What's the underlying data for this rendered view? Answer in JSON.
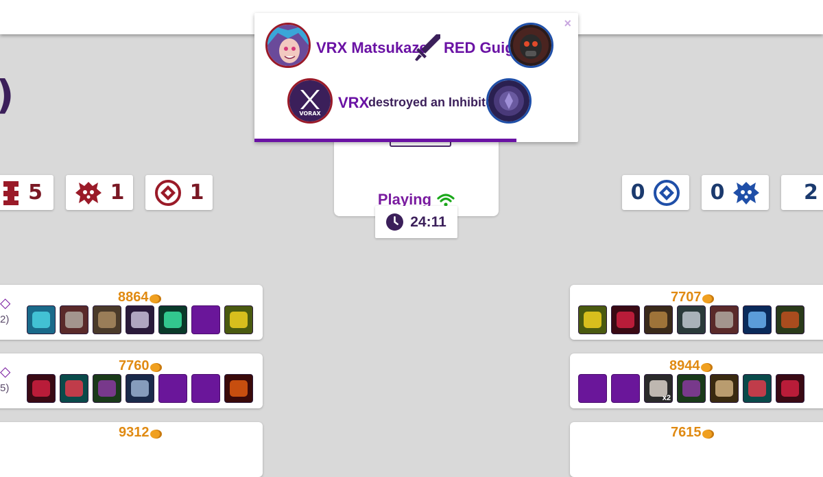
{
  "header": {
    "partial_title": ")"
  },
  "objectives": {
    "left": [
      {
        "icon": "tower-icon",
        "value": "5"
      },
      {
        "icon": "baron-icon",
        "value": "1"
      },
      {
        "icon": "inhibitor-icon",
        "value": "1"
      }
    ],
    "right": [
      {
        "icon": "inhibitor-icon",
        "value": "0"
      },
      {
        "icon": "baron-icon",
        "value": "0"
      },
      {
        "icon": "tower-icon",
        "value": "2"
      }
    ],
    "colors": {
      "red": "#7a1824",
      "blue": "#1b3a6e"
    }
  },
  "match": {
    "status": "Playing",
    "time": "24:11",
    "status_color": "#7a1ca0",
    "signal_color": "#1aa81a"
  },
  "notification": {
    "killer": "VRX Matsukaze",
    "victim": "RED Guigo",
    "team": "VRX",
    "event": "destroyed an Inhibitor",
    "close_label": "×",
    "progress": 0.81
  },
  "players": {
    "left": [
      {
        "gold": "8864",
        "side_small": "2)",
        "items": [
          "runic-blade",
          "boots",
          "hammer",
          "dagger",
          "potion",
          "empty",
          "sunflower"
        ]
      },
      {
        "gold": "7760",
        "side_small": "5)",
        "items": [
          "ruby",
          "swift-boots",
          "mask",
          "armor",
          "empty",
          "empty",
          "lava-tome"
        ]
      },
      {
        "gold": "9312"
      }
    ],
    "right": [
      {
        "gold": "7707",
        "items": [
          "sunflower",
          "ruby",
          "shield",
          "plate",
          "boots",
          "crystal",
          "helm"
        ]
      },
      {
        "gold": "8944",
        "items": [
          "empty",
          "empty",
          "ward-x2",
          "mask",
          "gauntlet",
          "swift-boots",
          "ruby"
        ]
      },
      {
        "gold": "7615"
      }
    ]
  }
}
